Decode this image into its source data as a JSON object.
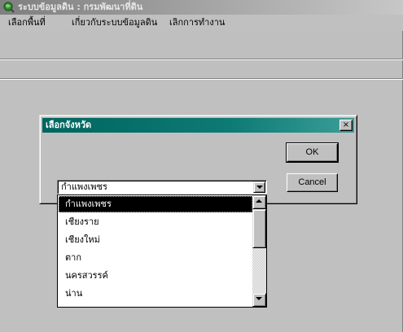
{
  "window": {
    "title": "ระบบข้อมูลดิน : กรมพัฒนาที่ดิน",
    "app_icon": "globe-magnifier-icon"
  },
  "menu": {
    "items": [
      "เลือกพื้นที่",
      "เกี่ยวกับระบบข้อมูลดิน",
      "เลิกการทำงาน"
    ]
  },
  "dialog": {
    "title": "เลือกจังหวัด",
    "close_glyph": "×",
    "ok_label": "OK",
    "cancel_label": "Cancel"
  },
  "province_select": {
    "value": "กำแพงเพชร",
    "options": [
      "กำแพงเพชร",
      "เชียงราย",
      "เชียงใหม่",
      "ตาก",
      "นครสวรรค์",
      "น่าน"
    ],
    "selected_index": 0
  },
  "colors": {
    "dialog_title_bar": "#00655f",
    "selection": "#000000",
    "face": "#c0c0c0"
  }
}
